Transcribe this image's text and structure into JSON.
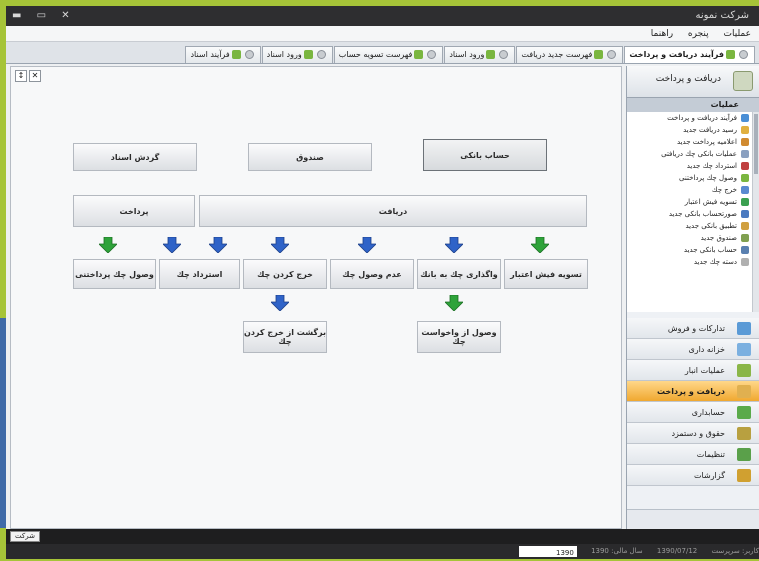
{
  "window": {
    "controls": "▬ ▭ ✕",
    "title": "شركت نمونه"
  },
  "menu": [
    "عمليات",
    "پنجره",
    "راهنما"
  ],
  "tabs": [
    {
      "label": "فرآيند دريافت و پرداخت",
      "active": true
    },
    {
      "label": "فهرست جديد دريافت",
      "active": false
    },
    {
      "label": "ورود اسناد",
      "active": false
    },
    {
      "label": "فهرست تسويه حساب",
      "active": false
    },
    {
      "label": "ورود اسناد",
      "active": false
    },
    {
      "label": "فرآيند اسناد",
      "active": false
    }
  ],
  "toolbar": {
    "pin": "↕",
    "close": "✕"
  },
  "diagram": {
    "top": [
      "حساب بانكی",
      "صندوق",
      "گردش اسناد"
    ],
    "cat_receive": "دريافت",
    "cat_pay": "پرداخت",
    "row1": [
      "تسويه فيش اعتبار",
      "واگذاری چك به بانك",
      "عدم وصول چك",
      "خرج كردن چك",
      "استرداد چك",
      "وصول چك پرداختنی"
    ],
    "row2": [
      "وصول از واخواست چك",
      "برگشت از خرج كردن چك"
    ]
  },
  "colors": {
    "blue_arrow": "#2f63c8",
    "green_arrow": "#2ea33a",
    "accent_active": "#f0a830"
  },
  "sidebar": {
    "header": "دريافت و پرداخت",
    "sub": "عمليات",
    "items": [
      "فرآيند دريافت و پرداخت",
      "رسيد دريافت جديد",
      "اعلاميه پرداخت جديد",
      "عمليات بانكی چك دريافتی",
      "استرداد چك جديد",
      "وصول چك پرداختنی",
      "خرج چك",
      "تسويه فيش اعتبار",
      "صورتحساب بانكی جديد",
      "تطبيق بانكی جديد",
      "صندوق جديد",
      "حساب بانكی جديد",
      "دسته چك جديد"
    ],
    "sections": [
      {
        "label": "تداركات و فروش",
        "color": "#5a9ad6",
        "active": false
      },
      {
        "label": "خزانه داری",
        "color": "#7bb0e0",
        "active": false
      },
      {
        "label": "عمليات انبار",
        "color": "#8ab648",
        "active": false
      },
      {
        "label": "دريافت و پرداخت",
        "color": "#e0b050",
        "active": true
      },
      {
        "label": "حسابداری",
        "color": "#5aaa4a",
        "active": false
      },
      {
        "label": "حقوق و دستمزد",
        "color": "#b8a040",
        "active": false
      },
      {
        "label": "تنظيمات",
        "color": "#5aa04a",
        "active": false
      },
      {
        "label": "گزارشات",
        "color": "#d0a030",
        "active": false
      }
    ]
  },
  "doc_tab": "شركت",
  "status": {
    "user": "کاربر: سرپرست",
    "date": "1390/07/12",
    "year": "سال مالی: 1390",
    "zoom": "1390"
  }
}
